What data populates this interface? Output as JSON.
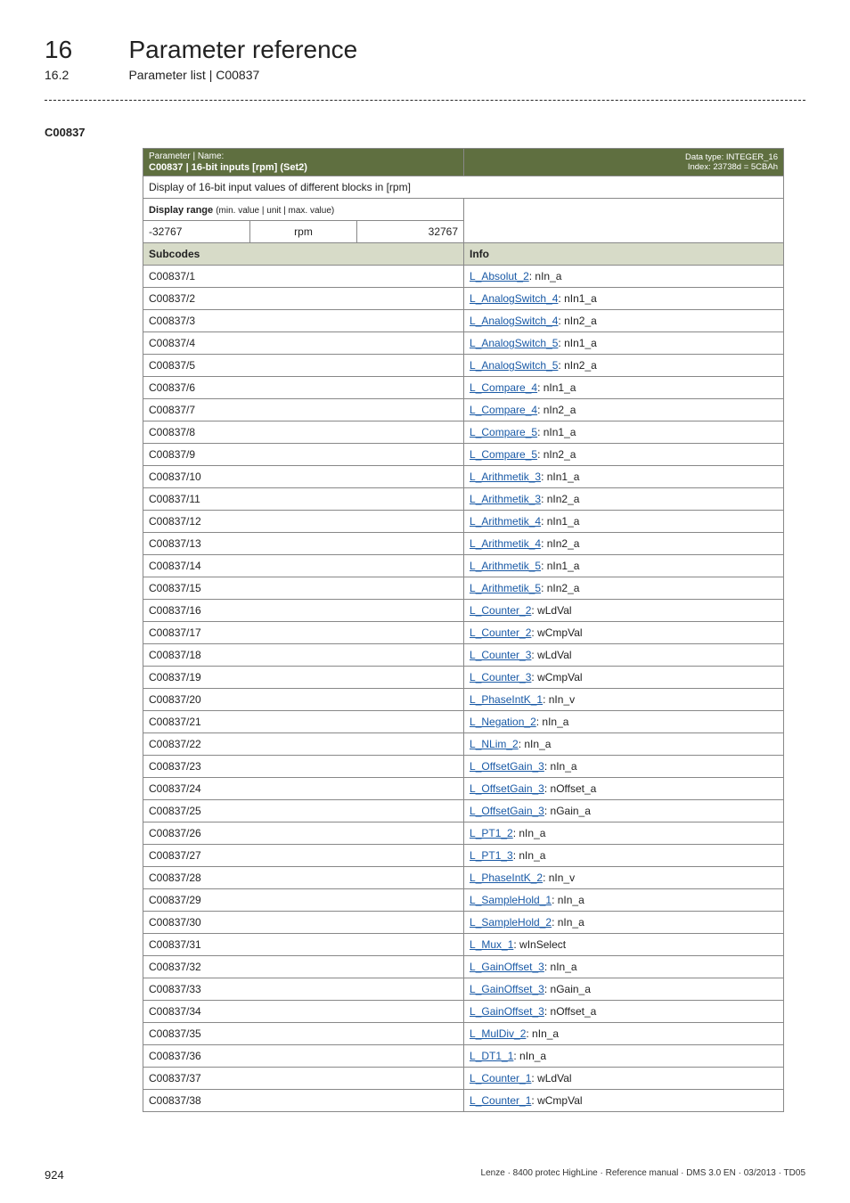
{
  "header": {
    "chapter_num": "16",
    "chapter_title": "Parameter reference",
    "section_num": "16.2",
    "section_title": "Parameter list | C00837"
  },
  "param_code_heading": "C00837",
  "table_header": {
    "left_label": "Parameter | Name:",
    "left_value": "C00837 | 16-bit inputs [rpm] (Set2)",
    "right_line1": "Data type: INTEGER_16",
    "right_line2": "Index: 23738d = 5CBAh"
  },
  "description": "Display of 16-bit input values of different blocks in [rpm]",
  "display_range": {
    "label": "Display range",
    "label_small": "(min. value | unit | max. value)",
    "min": "-32767",
    "unit": "rpm",
    "max": "32767"
  },
  "columns": {
    "subcodes": "Subcodes",
    "info": "Info"
  },
  "rows": [
    {
      "sub": "C00837/1",
      "link": "L_Absolut_2",
      "suffix": ": nIn_a"
    },
    {
      "sub": "C00837/2",
      "link": "L_AnalogSwitch_4",
      "suffix": ": nIn1_a"
    },
    {
      "sub": "C00837/3",
      "link": "L_AnalogSwitch_4",
      "suffix": ": nIn2_a"
    },
    {
      "sub": "C00837/4",
      "link": "L_AnalogSwitch_5",
      "suffix": ": nIn1_a"
    },
    {
      "sub": "C00837/5",
      "link": "L_AnalogSwitch_5",
      "suffix": ": nIn2_a"
    },
    {
      "sub": "C00837/6",
      "link": "L_Compare_4",
      "suffix": ": nIn1_a"
    },
    {
      "sub": "C00837/7",
      "link": "L_Compare_4",
      "suffix": ": nIn2_a"
    },
    {
      "sub": "C00837/8",
      "link": "L_Compare_5",
      "suffix": ": nIn1_a"
    },
    {
      "sub": "C00837/9",
      "link": "L_Compare_5",
      "suffix": ": nIn2_a"
    },
    {
      "sub": "C00837/10",
      "link": "L_Arithmetik_3",
      "suffix": ": nIn1_a"
    },
    {
      "sub": "C00837/11",
      "link": "L_Arithmetik_3",
      "suffix": ": nIn2_a"
    },
    {
      "sub": "C00837/12",
      "link": "L_Arithmetik_4",
      "suffix": ": nIn1_a"
    },
    {
      "sub": "C00837/13",
      "link": "L_Arithmetik_4",
      "suffix": ": nIn2_a"
    },
    {
      "sub": "C00837/14",
      "link": "L_Arithmetik_5",
      "suffix": ": nIn1_a"
    },
    {
      "sub": "C00837/15",
      "link": "L_Arithmetik_5",
      "suffix": ": nIn2_a"
    },
    {
      "sub": "C00837/16",
      "link": "L_Counter_2",
      "suffix": ": wLdVal"
    },
    {
      "sub": "C00837/17",
      "link": "L_Counter_2",
      "suffix": ": wCmpVal"
    },
    {
      "sub": "C00837/18",
      "link": "L_Counter_3",
      "suffix": ": wLdVal"
    },
    {
      "sub": "C00837/19",
      "link": "L_Counter_3",
      "suffix": ": wCmpVal"
    },
    {
      "sub": "C00837/20",
      "link": "L_PhaseIntK_1",
      "suffix": ": nIn_v"
    },
    {
      "sub": "C00837/21",
      "link": "L_Negation_2",
      "suffix": ": nIn_a"
    },
    {
      "sub": "C00837/22",
      "link": "L_NLim_2",
      "suffix": ": nIn_a"
    },
    {
      "sub": "C00837/23",
      "link": "L_OffsetGain_3",
      "suffix": ": nIn_a"
    },
    {
      "sub": "C00837/24",
      "link": "L_OffsetGain_3",
      "suffix": ": nOffset_a"
    },
    {
      "sub": "C00837/25",
      "link": "L_OffsetGain_3",
      "suffix": ": nGain_a"
    },
    {
      "sub": "C00837/26",
      "link": "L_PT1_2",
      "suffix": ": nIn_a"
    },
    {
      "sub": "C00837/27",
      "link": "L_PT1_3",
      "suffix": ": nIn_a"
    },
    {
      "sub": "C00837/28",
      "link": "L_PhaseIntK_2",
      "suffix": ": nIn_v"
    },
    {
      "sub": "C00837/29",
      "link": "L_SampleHold_1",
      "suffix": ": nIn_a"
    },
    {
      "sub": "C00837/30",
      "link": "L_SampleHold_2",
      "suffix": ": nIn_a"
    },
    {
      "sub": "C00837/31",
      "link": "L_Mux_1",
      "suffix": ": wInSelect"
    },
    {
      "sub": "C00837/32",
      "link": "L_GainOffset_3",
      "suffix": ": nIn_a"
    },
    {
      "sub": "C00837/33",
      "link": "L_GainOffset_3",
      "suffix": ": nGain_a"
    },
    {
      "sub": "C00837/34",
      "link": "L_GainOffset_3",
      "suffix": ": nOffset_a"
    },
    {
      "sub": "C00837/35",
      "link": "L_MulDiv_2",
      "suffix": ": nIn_a"
    },
    {
      "sub": "C00837/36",
      "link": "L_DT1_1",
      "suffix": ": nIn_a"
    },
    {
      "sub": "C00837/37",
      "link": "L_Counter_1",
      "suffix": ": wLdVal"
    },
    {
      "sub": "C00837/38",
      "link": "L_Counter_1",
      "suffix": ": wCmpVal"
    }
  ],
  "footer": {
    "page": "924",
    "text": "Lenze · 8400 protec HighLine · Reference manual · DMS 3.0 EN · 03/2013 · TD05"
  }
}
